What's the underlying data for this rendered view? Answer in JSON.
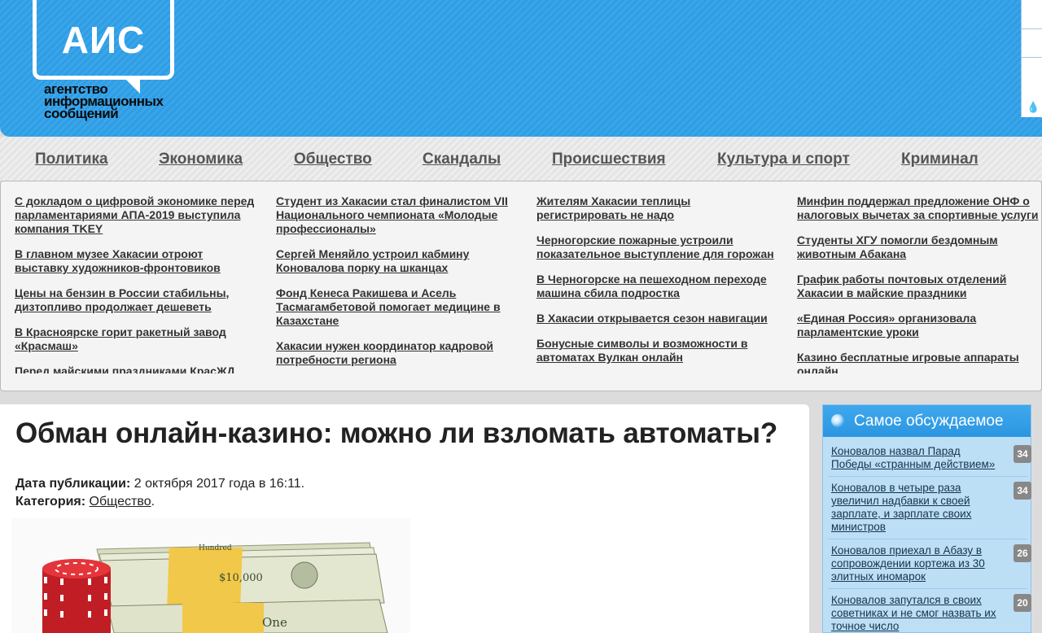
{
  "header": {
    "logo": "АИС",
    "logo_sub": [
      "агентство",
      "информационных",
      "сообщений"
    ]
  },
  "nav": [
    "Политика",
    "Экономика",
    "Общество",
    "Скандалы",
    "Происшествия",
    "Культура и спорт",
    "Криминал"
  ],
  "news_columns": [
    [
      "С докладом о цифровой экономике перед парламентариями АПА-2019 выступила компания TKEY",
      "В главном музее Хакасии отроют выставку художников-фронтовиков",
      "Цены на бензин в России стабильны, дизтопливо продолжает дешеветь",
      "В Красноярске горит ракетный завод «Красмаш»",
      "Перед майскими праздниками КрасЖД"
    ],
    [
      "Студент из Хакасии стал финалистом VII Национального чемпионата «Молодые профессионалы»",
      "Сергей Меняйло устроил кабмину Коновалова порку на шканцах",
      "Фонд Кенеса Ракишева и Асель Тасмагамбетовой помогает медицине в Казахстане",
      "Хакасии нужен координатор кадровой потребности региона"
    ],
    [
      "Жителям Хакасии теплицы регистрировать не надо",
      "Черногорские пожарные устроили показательное выступление для горожан",
      "В Черногорске на пешеходном переходе машина сбила подростка",
      "В Хакасии открывается сезон навигации",
      "Бонусные символы и возможности в автоматах Вулкан онлайн"
    ],
    [
      "Минфин поддержал предложение ОНФ о налоговых вычетах за спортивные услуги",
      "Студенты ХГУ помогли бездомным животным Абакана",
      "График работы почтовых отделений Хакасии в майские праздники",
      "«Единая Россия» организовала парламентские уроки",
      "Казино бесплатные игровые аппараты онлайн"
    ]
  ],
  "article": {
    "title": "Обман онлайн-казино: можно ли взломать автоматы?",
    "date_label": "Дата публикации:",
    "date_value": "2 октября 2017 года в 16:11.",
    "category_label": "Категория:",
    "category_value": "Общество",
    "category_suffix": "."
  },
  "sidebar": {
    "title": "Самое обсуждаемое",
    "items": [
      {
        "text": "Коновалов назвал Парад Победы «странным действием»",
        "count": "34"
      },
      {
        "text": "Коновалов в четыре раза увеличил надбавки к своей зарплате, и зарплате своих министров",
        "count": "34"
      },
      {
        "text": "Коновалов приехал в Абазу в сопровождении кортежа из 30 элитных иномарок",
        "count": "26"
      },
      {
        "text": "Коновалов запутался в своих советниках и не смог назвать их точное число",
        "count": "20"
      }
    ]
  },
  "image": {
    "banknote_text": [
      "$10,000",
      "One",
      "Hundred"
    ]
  }
}
